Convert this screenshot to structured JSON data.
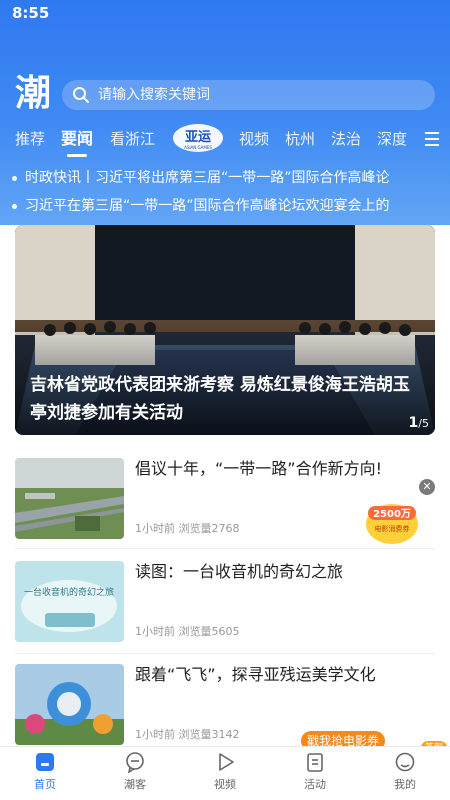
{
  "status_bar": {
    "time": "8:55"
  },
  "app": {
    "logo_text": "潮"
  },
  "search": {
    "placeholder": "请输入搜索关键词"
  },
  "tabs": [
    {
      "label": "推荐"
    },
    {
      "label": "要闻",
      "active": true
    },
    {
      "label": "看浙江"
    },
    {
      "label": "亚运",
      "badge": true,
      "badge_sub": "ASIAN GAMES"
    },
    {
      "label": "视频"
    },
    {
      "label": "杭州"
    },
    {
      "label": "法治"
    },
    {
      "label": "深度"
    }
  ],
  "ticker": [
    "时政快讯丨习近平将出席第三届“一带一路”国际合作高峰论",
    "习近平在第三届“一带一路”国际合作高峰论坛欢迎宴会上的"
  ],
  "hero": {
    "caption": "吉林省党政代表团来浙考察 易炼红景俊海王浩胡玉亭刘捷参加有关活动",
    "counter_current": "1",
    "counter_total": "/5"
  },
  "articles": [
    {
      "title": "倡议十年，“一带一路”合作新方向!",
      "time": "1小时前",
      "views": "浏览量2768"
    },
    {
      "title": "读图：一台收音机的奇幻之旅",
      "time": "1小时前",
      "views": "浏览量5605",
      "thumb_text": "一台收音机的奇幻之旅"
    },
    {
      "title": "跟着“飞飞”，探寻亚残运美学文化",
      "time": "1小时前",
      "views": "浏览量3142"
    }
  ],
  "ads": {
    "close_symbol": "✕",
    "float_ad_line1": "2500万",
    "float_ad_line2": "电影消费券",
    "promo_pill": "戳我抢电影券",
    "tag_badge": "签到"
  },
  "bottom_nav": [
    {
      "label": "首页",
      "icon": "home-icon",
      "active": true
    },
    {
      "label": "潮客",
      "icon": "chat-icon"
    },
    {
      "label": "视频",
      "icon": "play-icon"
    },
    {
      "label": "活动",
      "icon": "activity-icon"
    },
    {
      "label": "我的",
      "icon": "profile-icon"
    }
  ],
  "colors": {
    "brand_blue": "#2f79f0",
    "accent_orange": "#f48a1e"
  }
}
